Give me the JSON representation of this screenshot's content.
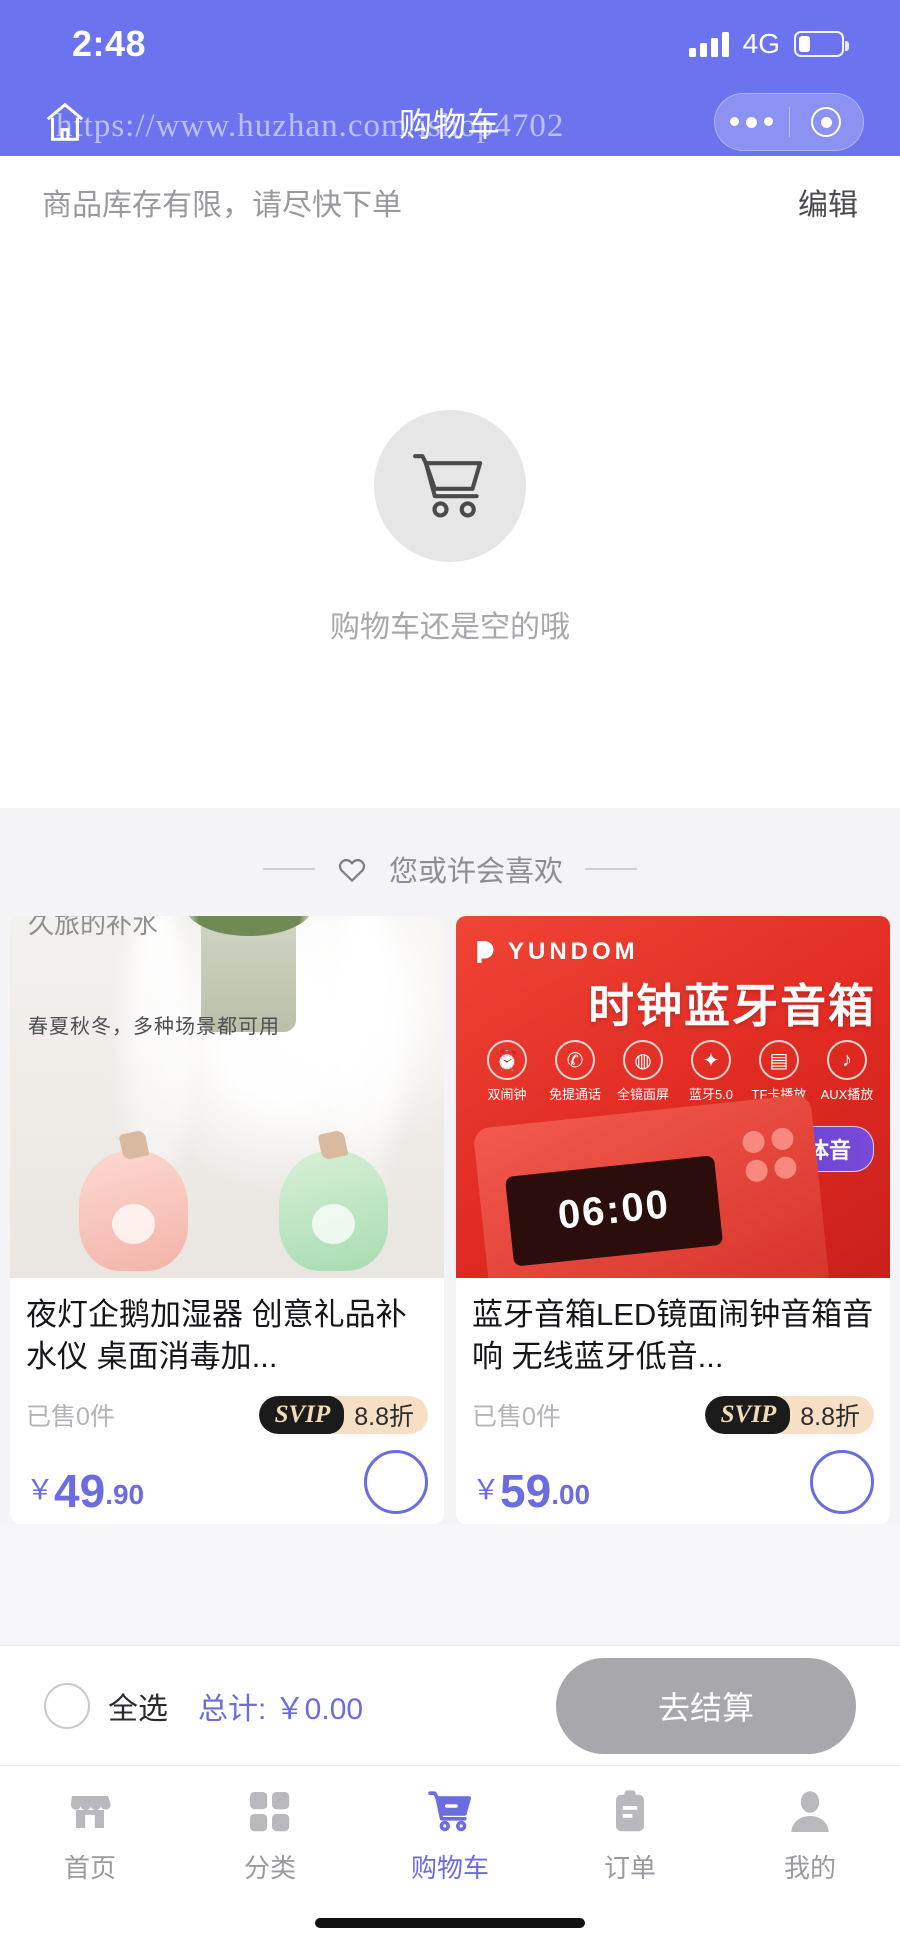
{
  "status_bar": {
    "time": "2:48",
    "network": "4G",
    "signal_icon": "signal-bars-icon",
    "battery_icon": "battery-icon"
  },
  "nav": {
    "title": "购物车",
    "home_icon": "home-icon",
    "menu_icon": "more-dots-icon",
    "close_icon": "target-circle-icon"
  },
  "watermark": "https://www.huzhan.com/ishop4702",
  "notice": {
    "text": "商品库存有限，请尽快下单",
    "edit_label": "编辑"
  },
  "empty": {
    "icon": "shopping-cart-icon",
    "text": "购物车还是空的哦"
  },
  "recommend": {
    "heart_icon": "heart-icon",
    "title": "您或许会喜欢",
    "products": [
      {
        "image_caption_top": "久旅的补水",
        "image_caption": "春夏秋冬，多种场景都可用",
        "title": "夜灯企鹅加湿器 创意礼品补水仪 桌面消毒加...",
        "sold": "已售0件",
        "badge_label": "SVIP",
        "badge_value": "8.8折",
        "currency": "￥",
        "price_int": "49",
        "price_dec": ".90",
        "add_icon": "add-to-cart-icon"
      },
      {
        "brand": "YUNDOM",
        "banner_title": "时钟蓝牙音箱",
        "banner_pill": "双喇叭立体音",
        "display_time": "06:00",
        "features": [
          {
            "icon": "alarm-icon",
            "label": "双闹钟"
          },
          {
            "icon": "phone-icon",
            "label": "免提通话"
          },
          {
            "icon": "mirror-icon",
            "label": "全镜面屏"
          },
          {
            "icon": "bluetooth-icon",
            "label": "蓝牙5.0"
          },
          {
            "icon": "tfcard-icon",
            "label": "TF卡播放"
          },
          {
            "icon": "aux-icon",
            "label": "AUX播放"
          }
        ],
        "title": "蓝牙音箱LED镜面闹钟音箱音响 无线蓝牙低音...",
        "sold": "已售0件",
        "badge_label": "SVIP",
        "badge_value": "8.8折",
        "currency": "￥",
        "price_int": "59",
        "price_dec": ".00",
        "add_icon": "add-to-cart-icon"
      }
    ]
  },
  "checkout": {
    "select_all": "全选",
    "total": "总计: ￥0.00",
    "button": "去结算"
  },
  "tabbar": {
    "items": [
      {
        "icon": "store-icon",
        "label": "首页",
        "active": false
      },
      {
        "icon": "grid-icon",
        "label": "分类",
        "active": false
      },
      {
        "icon": "cart-icon",
        "label": "购物车",
        "active": true
      },
      {
        "icon": "clipboard-icon",
        "label": "订单",
        "active": false
      },
      {
        "icon": "user-icon",
        "label": "我的",
        "active": false
      }
    ]
  },
  "colors": {
    "brand": "#6b74ee",
    "accent": "#6b6ce0",
    "muted": "#9a9a9f"
  }
}
